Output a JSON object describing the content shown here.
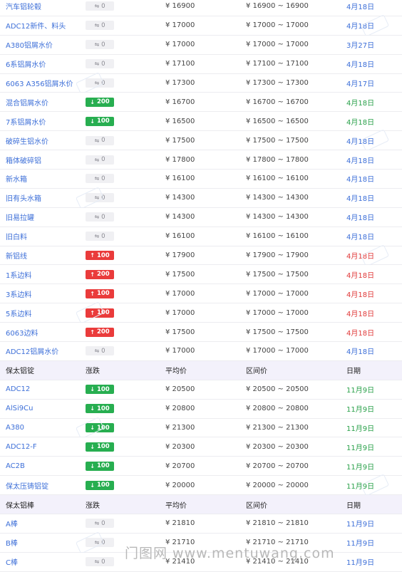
{
  "rows": [
    {
      "type": "data",
      "name": "汽车铝轮毂",
      "dir": "flat",
      "change": "0",
      "avg": "¥ 16900",
      "range": "¥ 16900 ~ 16900",
      "date": "4月18日",
      "date_color": "blue"
    },
    {
      "type": "data",
      "name": "ADC12新件、料头",
      "dir": "flat",
      "change": "0",
      "avg": "¥ 17000",
      "range": "¥ 17000 ~ 17000",
      "date": "4月18日",
      "date_color": "blue"
    },
    {
      "type": "data",
      "name": "A380铝屑水价",
      "dir": "flat",
      "change": "0",
      "avg": "¥ 17000",
      "range": "¥ 17000 ~ 17000",
      "date": "3月27日",
      "date_color": "blue"
    },
    {
      "type": "data",
      "name": "6系铝屑水价",
      "dir": "flat",
      "change": "0",
      "avg": "¥ 17100",
      "range": "¥ 17100 ~ 17100",
      "date": "4月18日",
      "date_color": "blue"
    },
    {
      "type": "data",
      "name": "6063 A356铝屑水价",
      "dir": "flat",
      "change": "0",
      "avg": "¥ 17300",
      "range": "¥ 17300 ~ 17300",
      "date": "4月17日",
      "date_color": "blue"
    },
    {
      "type": "data",
      "name": "混合铝屑水价",
      "dir": "down",
      "change": "200",
      "avg": "¥ 16700",
      "range": "¥ 16700 ~ 16700",
      "date": "4月18日",
      "date_color": "green"
    },
    {
      "type": "data",
      "name": "7系铝屑水价",
      "dir": "down",
      "change": "100",
      "avg": "¥ 16500",
      "range": "¥ 16500 ~ 16500",
      "date": "4月18日",
      "date_color": "green"
    },
    {
      "type": "data",
      "name": "破碎生铝水价",
      "dir": "flat",
      "change": "0",
      "avg": "¥ 17500",
      "range": "¥ 17500 ~ 17500",
      "date": "4月18日",
      "date_color": "blue"
    },
    {
      "type": "data",
      "name": "箱体破碎铝",
      "dir": "flat",
      "change": "0",
      "avg": "¥ 17800",
      "range": "¥ 17800 ~ 17800",
      "date": "4月18日",
      "date_color": "blue"
    },
    {
      "type": "data",
      "name": "新水箱",
      "dir": "flat",
      "change": "0",
      "avg": "¥ 16100",
      "range": "¥ 16100 ~ 16100",
      "date": "4月18日",
      "date_color": "blue"
    },
    {
      "type": "data",
      "name": "旧有头水箱",
      "dir": "flat",
      "change": "0",
      "avg": "¥ 14300",
      "range": "¥ 14300 ~ 14300",
      "date": "4月18日",
      "date_color": "blue"
    },
    {
      "type": "data",
      "name": "旧易拉罐",
      "dir": "flat",
      "change": "0",
      "avg": "¥ 14300",
      "range": "¥ 14300 ~ 14300",
      "date": "4月18日",
      "date_color": "blue"
    },
    {
      "type": "data",
      "name": "旧白料",
      "dir": "flat",
      "change": "0",
      "avg": "¥ 16100",
      "range": "¥ 16100 ~ 16100",
      "date": "4月18日",
      "date_color": "blue"
    },
    {
      "type": "data",
      "name": "新铝线",
      "dir": "up",
      "change": "100",
      "avg": "¥ 17900",
      "range": "¥ 17900 ~ 17900",
      "date": "4月18日",
      "date_color": "red"
    },
    {
      "type": "data",
      "name": "1系边料",
      "dir": "up",
      "change": "200",
      "avg": "¥ 17500",
      "range": "¥ 17500 ~ 17500",
      "date": "4月18日",
      "date_color": "red"
    },
    {
      "type": "data",
      "name": "3系边料",
      "dir": "up",
      "change": "100",
      "avg": "¥ 17000",
      "range": "¥ 17000 ~ 17000",
      "date": "4月18日",
      "date_color": "red"
    },
    {
      "type": "data",
      "name": "5系边料",
      "dir": "up",
      "change": "100",
      "avg": "¥ 17000",
      "range": "¥ 17000 ~ 17000",
      "date": "4月18日",
      "date_color": "red"
    },
    {
      "type": "data",
      "name": "6063边料",
      "dir": "up",
      "change": "200",
      "avg": "¥ 17500",
      "range": "¥ 17500 ~ 17500",
      "date": "4月18日",
      "date_color": "red"
    },
    {
      "type": "data",
      "name": "ADC12铝屑水价",
      "dir": "flat",
      "change": "0",
      "avg": "¥ 17000",
      "range": "¥ 17000 ~ 17000",
      "date": "4月18日",
      "date_color": "blue"
    },
    {
      "type": "header",
      "name": "保太铝锭",
      "change": "涨跌",
      "avg": "平均价",
      "range": "区间价",
      "date": "日期"
    },
    {
      "type": "data",
      "name": "ADC12",
      "dir": "down",
      "change": "100",
      "avg": "¥ 20500",
      "range": "¥ 20500 ~ 20500",
      "date": "11月9日",
      "date_color": "green"
    },
    {
      "type": "data",
      "name": "AlSi9Cu",
      "dir": "down",
      "change": "100",
      "avg": "¥ 20800",
      "range": "¥ 20800 ~ 20800",
      "date": "11月9日",
      "date_color": "green"
    },
    {
      "type": "data",
      "name": "A380",
      "dir": "down",
      "change": "100",
      "avg": "¥ 21300",
      "range": "¥ 21300 ~ 21300",
      "date": "11月9日",
      "date_color": "green"
    },
    {
      "type": "data",
      "name": "ADC12-F",
      "dir": "down",
      "change": "100",
      "avg": "¥ 20300",
      "range": "¥ 20300 ~ 20300",
      "date": "11月9日",
      "date_color": "green"
    },
    {
      "type": "data",
      "name": "AC2B",
      "dir": "down",
      "change": "100",
      "avg": "¥ 20700",
      "range": "¥ 20700 ~ 20700",
      "date": "11月9日",
      "date_color": "green"
    },
    {
      "type": "data",
      "name": "保太压铸铝锭",
      "dir": "down",
      "change": "100",
      "avg": "¥ 20000",
      "range": "¥ 20000 ~ 20000",
      "date": "11月9日",
      "date_color": "green"
    },
    {
      "type": "header",
      "name": "保太铝棒",
      "change": "涨跌",
      "avg": "平均价",
      "range": "区间价",
      "date": "日期"
    },
    {
      "type": "data",
      "name": "A棒",
      "dir": "flat",
      "change": "0",
      "avg": "¥ 21810",
      "range": "¥ 21810 ~ 21810",
      "date": "11月9日",
      "date_color": "blue"
    },
    {
      "type": "data",
      "name": "B棒",
      "dir": "flat",
      "change": "0",
      "avg": "¥ 21710",
      "range": "¥ 21710 ~ 21710",
      "date": "11月9日",
      "date_color": "blue"
    },
    {
      "type": "data",
      "name": "C棒",
      "dir": "flat",
      "change": "0",
      "avg": "¥ 21410",
      "range": "¥ 21410 ~ 21410",
      "date": "11月9日",
      "date_color": "blue"
    }
  ],
  "arrow_glyphs": {
    "flat": "⇋",
    "down": "↓",
    "up": "↑"
  },
  "colors": {
    "up": "#ea3b3b",
    "down": "#27ae50",
    "link": "#3d6fd8",
    "header_bg": "#f3f1fb"
  },
  "watermark": "门图网 www.mentuwang.com"
}
